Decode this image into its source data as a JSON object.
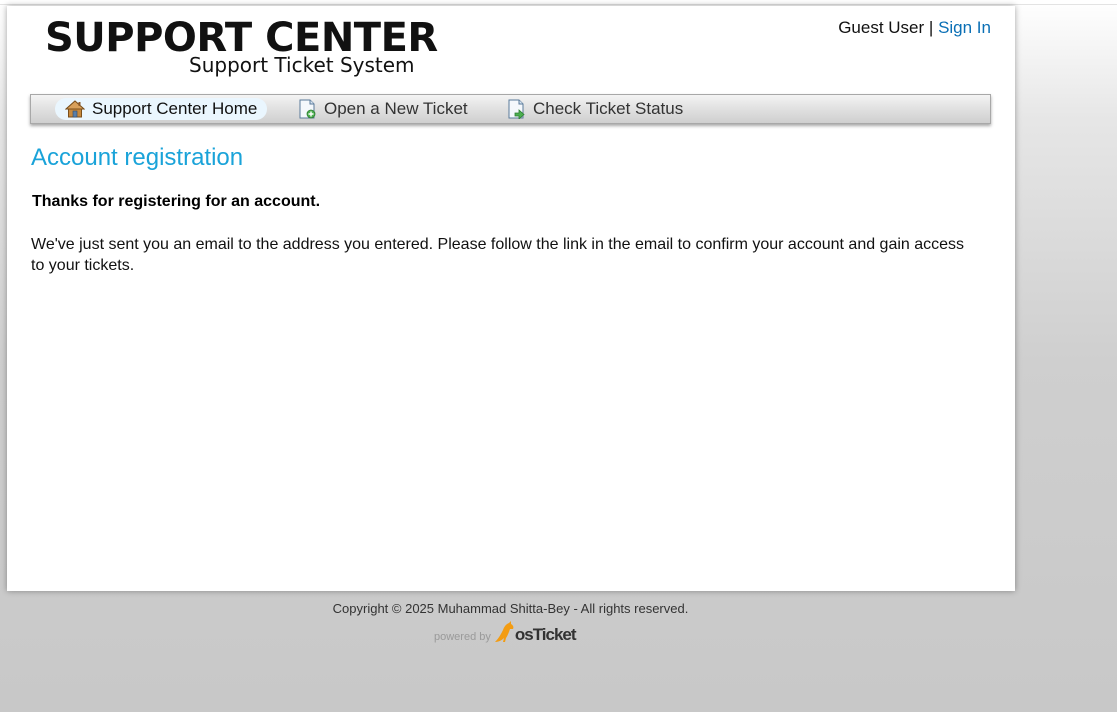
{
  "header": {
    "logo_title": "SUPPORT CENTER",
    "logo_subtitle": "Support Ticket System",
    "user_label": "Guest User",
    "separator": "|",
    "signin_label": "Sign In"
  },
  "nav": {
    "items": [
      {
        "label": "Support Center Home",
        "icon": "home-icon",
        "active": true
      },
      {
        "label": "Open a New Ticket",
        "icon": "new-ticket-icon",
        "active": false
      },
      {
        "label": "Check Ticket Status",
        "icon": "ticket-status-icon",
        "active": false
      }
    ]
  },
  "main": {
    "title": "Account registration",
    "thanks": "Thanks for registering for an account.",
    "message": "We've just sent you an email to the address you entered. Please follow the link in the email to confirm your account and gain access to your tickets."
  },
  "footer": {
    "copyright": "Copyright © 2025 Muhammad Shitta-Bey - All rights reserved.",
    "powered_by": "powered by",
    "brand": "osTicket"
  },
  "colors": {
    "title": "#1aa3d9",
    "link": "#0a6fb5",
    "nav_active_bg": "#eaf6fe"
  }
}
